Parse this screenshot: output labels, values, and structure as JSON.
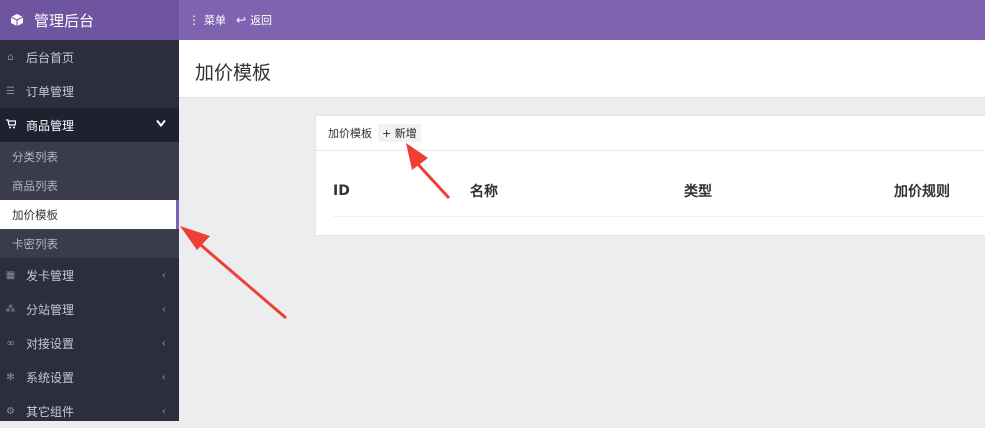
{
  "app": {
    "title": "管理后台"
  },
  "topnav": {
    "menu_label": "菜单",
    "back_label": "返回"
  },
  "sidebar": {
    "items": [
      {
        "label": "后台首页",
        "icon": "home-icon"
      },
      {
        "label": "订单管理",
        "icon": "list-icon"
      },
      {
        "label": "商品管理",
        "icon": "cart-icon",
        "active": true,
        "children": [
          {
            "label": "分类列表"
          },
          {
            "label": "商品列表"
          },
          {
            "label": "加价模板",
            "selected": true
          },
          {
            "label": "卡密列表"
          }
        ]
      },
      {
        "label": "发卡管理",
        "icon": "grid-icon"
      },
      {
        "label": "分站管理",
        "icon": "sitemap-icon"
      },
      {
        "label": "对接设置",
        "icon": "link-icon"
      },
      {
        "label": "系统设置",
        "icon": "gear-icon"
      },
      {
        "label": "其它组件",
        "icon": "cogs-icon"
      }
    ]
  },
  "page": {
    "title": "加价模板"
  },
  "panel": {
    "title": "加价模板",
    "add_label": "新增",
    "columns": [
      "ID",
      "名称",
      "类型",
      "加价规则"
    ]
  },
  "colors": {
    "accent": "#7f62b0",
    "sidebar": "#2c2e3e",
    "annotation_arrow": "#ef3f34"
  }
}
